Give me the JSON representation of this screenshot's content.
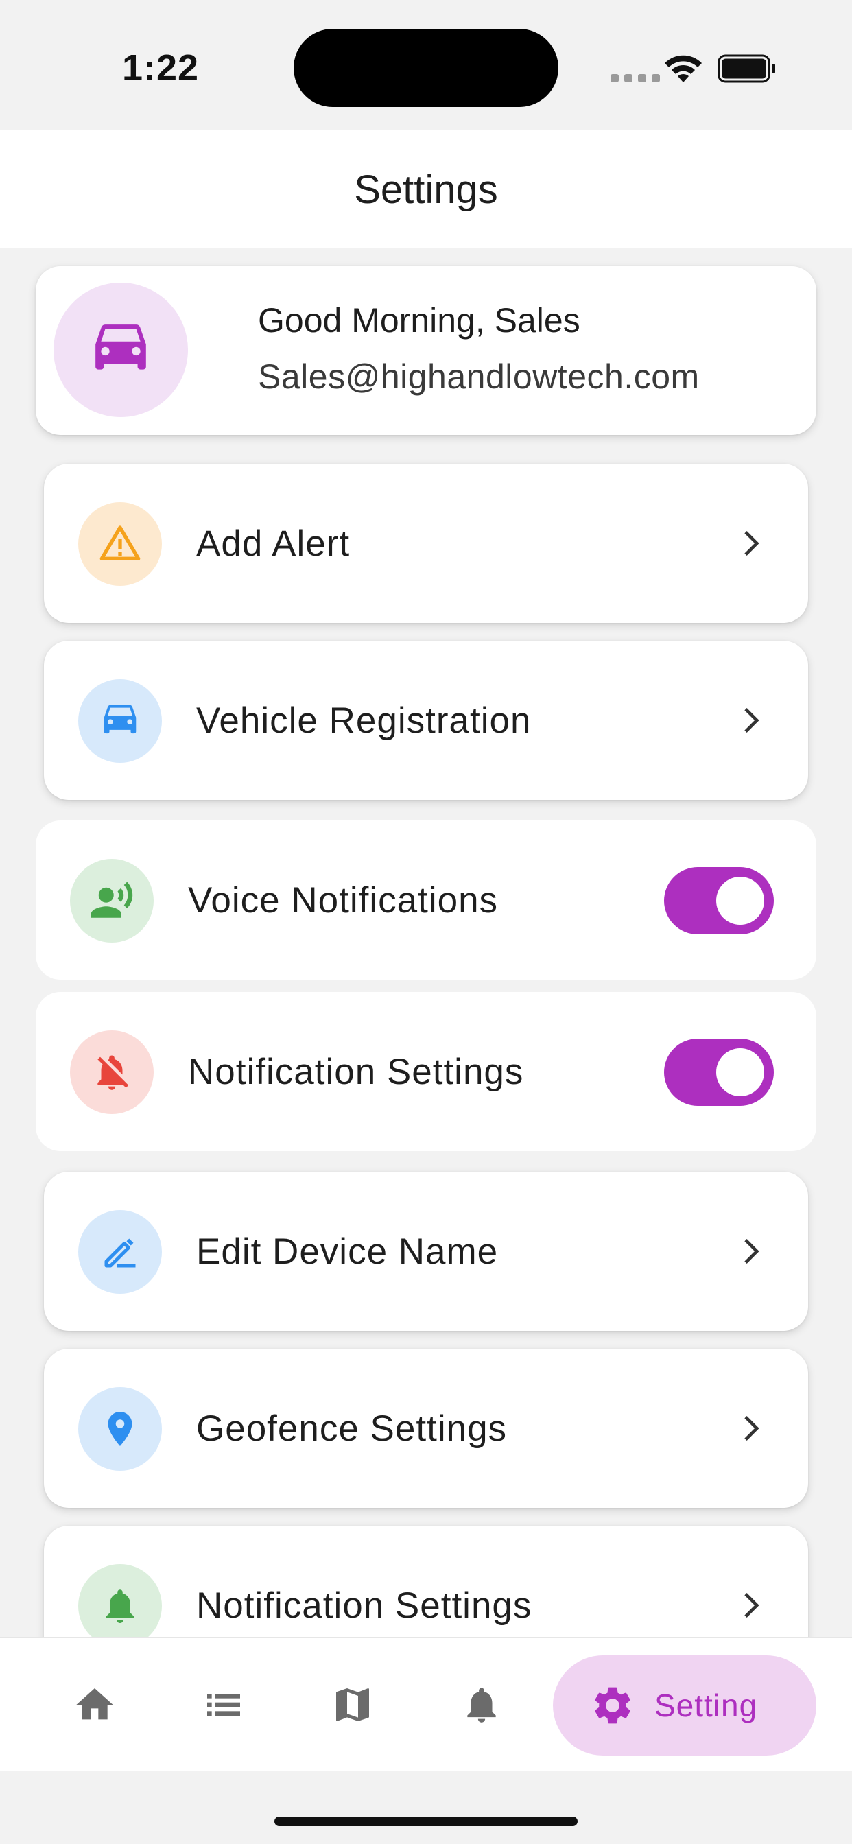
{
  "status_bar": {
    "time": "1:22"
  },
  "header": {
    "title": "Settings"
  },
  "profile": {
    "greeting": "Good Morning, Sales",
    "email": "Sales@highandlowtech.com",
    "icon": "car-icon"
  },
  "settings": [
    {
      "label": "Add Alert",
      "icon": "warning-icon",
      "type": "link"
    },
    {
      "label": "Vehicle Registration",
      "icon": "car-icon",
      "type": "link"
    },
    {
      "label": "Voice Notifications",
      "icon": "voice-icon",
      "type": "toggle",
      "on": true
    },
    {
      "label": "Notification Settings",
      "icon": "bell-off-icon",
      "type": "toggle",
      "on": true
    },
    {
      "label": "Edit Device Name",
      "icon": "edit-icon",
      "type": "link"
    },
    {
      "label": "Geofence Settings",
      "icon": "location-pin-icon",
      "type": "link"
    },
    {
      "label": "Notification Settings",
      "icon": "bell-icon",
      "type": "link"
    }
  ],
  "bottom_nav": {
    "items": [
      {
        "icon": "home-icon"
      },
      {
        "icon": "list-icon"
      },
      {
        "icon": "map-icon"
      },
      {
        "icon": "bell-icon"
      }
    ],
    "active": {
      "icon": "gear-icon",
      "label": "Setting"
    }
  },
  "colors": {
    "accent": "#ad2fbf",
    "accent_light": "#f0d4f2",
    "warning": "#f5a21c",
    "blue": "#2e8ff0",
    "green": "#48a64c",
    "red": "#e8453c"
  }
}
